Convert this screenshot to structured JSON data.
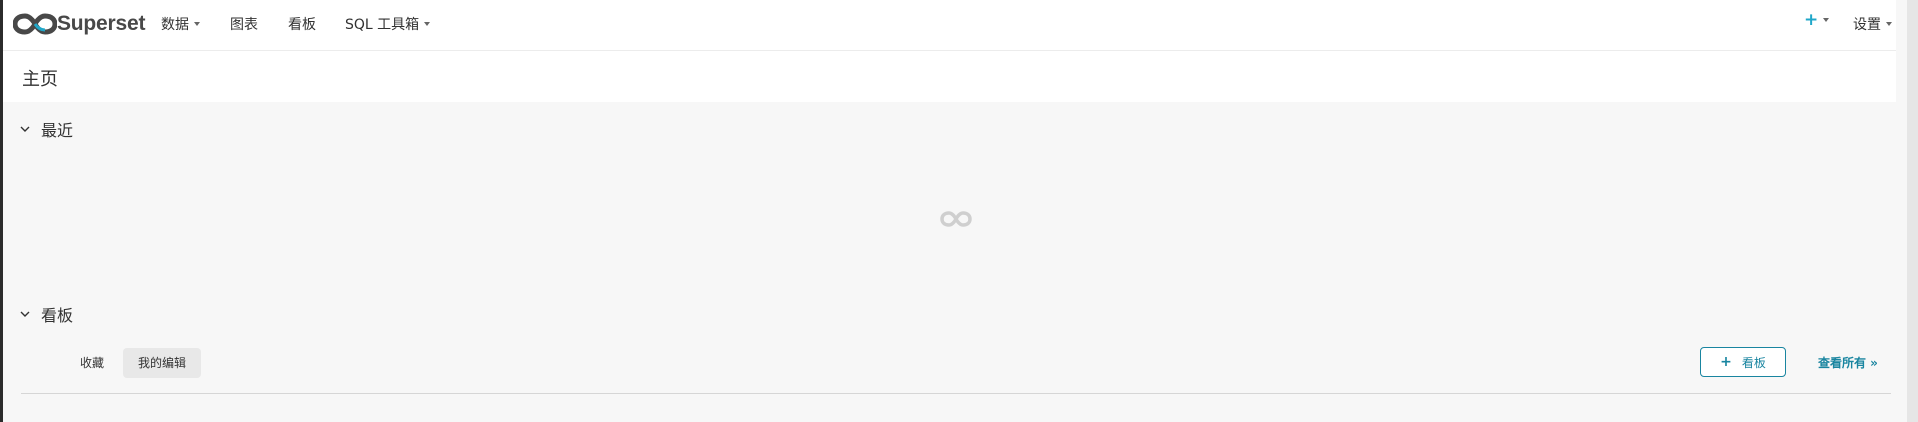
{
  "navbar": {
    "brand": "Superset",
    "menu": [
      {
        "label": "数据",
        "has_caret": true
      },
      {
        "label": "图表",
        "has_caret": false
      },
      {
        "label": "看板",
        "has_caret": false
      },
      {
        "label": "SQL 工具箱",
        "has_caret": true
      }
    ],
    "right": {
      "new_icon": "plus-icon",
      "settings_label": "设置"
    }
  },
  "page": {
    "title": "主页"
  },
  "sections": {
    "recent": {
      "title": "最近",
      "state": "loading"
    },
    "dashboards": {
      "title": "看板",
      "tabs": [
        {
          "label": "收藏",
          "active": false
        },
        {
          "label": "我的编辑",
          "active": true
        }
      ],
      "add_button": "看板",
      "view_all": "查看所有 »"
    }
  },
  "colors": {
    "accent": "#1985a0",
    "plus": "#20a7c9",
    "background": "#f7f7f7"
  }
}
